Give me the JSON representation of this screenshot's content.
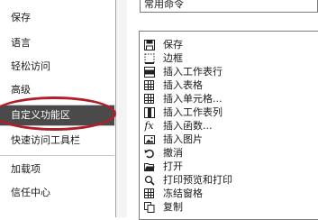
{
  "nav": {
    "items": [
      {
        "label": "保存"
      },
      {
        "label": "语言"
      },
      {
        "label": "轻松访问"
      },
      {
        "label": "高级"
      },
      {
        "label": "自定义功能区"
      },
      {
        "label": "快速访问工具栏"
      },
      {
        "label": "加载项"
      },
      {
        "label": "信任中心"
      }
    ],
    "selected": "自定义功能区"
  },
  "dropdown": {
    "value": "常用命令"
  },
  "commands": [
    {
      "label": "保存",
      "icon": "save-icon"
    },
    {
      "label": "边框",
      "icon": "border-icon"
    },
    {
      "label": "插入工作表行",
      "icon": "insert-row-icon"
    },
    {
      "label": "插入表格",
      "icon": "table-icon"
    },
    {
      "label": "插入单元格...",
      "icon": "insert-cells-icon"
    },
    {
      "label": "插入工作表列",
      "icon": "insert-column-icon"
    },
    {
      "label": "插入函数...",
      "icon": "function-icon"
    },
    {
      "label": "插入图片",
      "icon": "picture-icon"
    },
    {
      "label": "撤消",
      "icon": "undo-icon"
    },
    {
      "label": "打开",
      "icon": "open-folder-icon"
    },
    {
      "label": "打印预览和打印",
      "icon": "print-preview-icon"
    },
    {
      "label": "冻结窗格",
      "icon": "freeze-panes-icon"
    },
    {
      "label": "复制",
      "icon": "copy-icon"
    }
  ],
  "colors": {
    "selected_bg": "#4a4a4a",
    "annotation": "#b11e2a"
  }
}
